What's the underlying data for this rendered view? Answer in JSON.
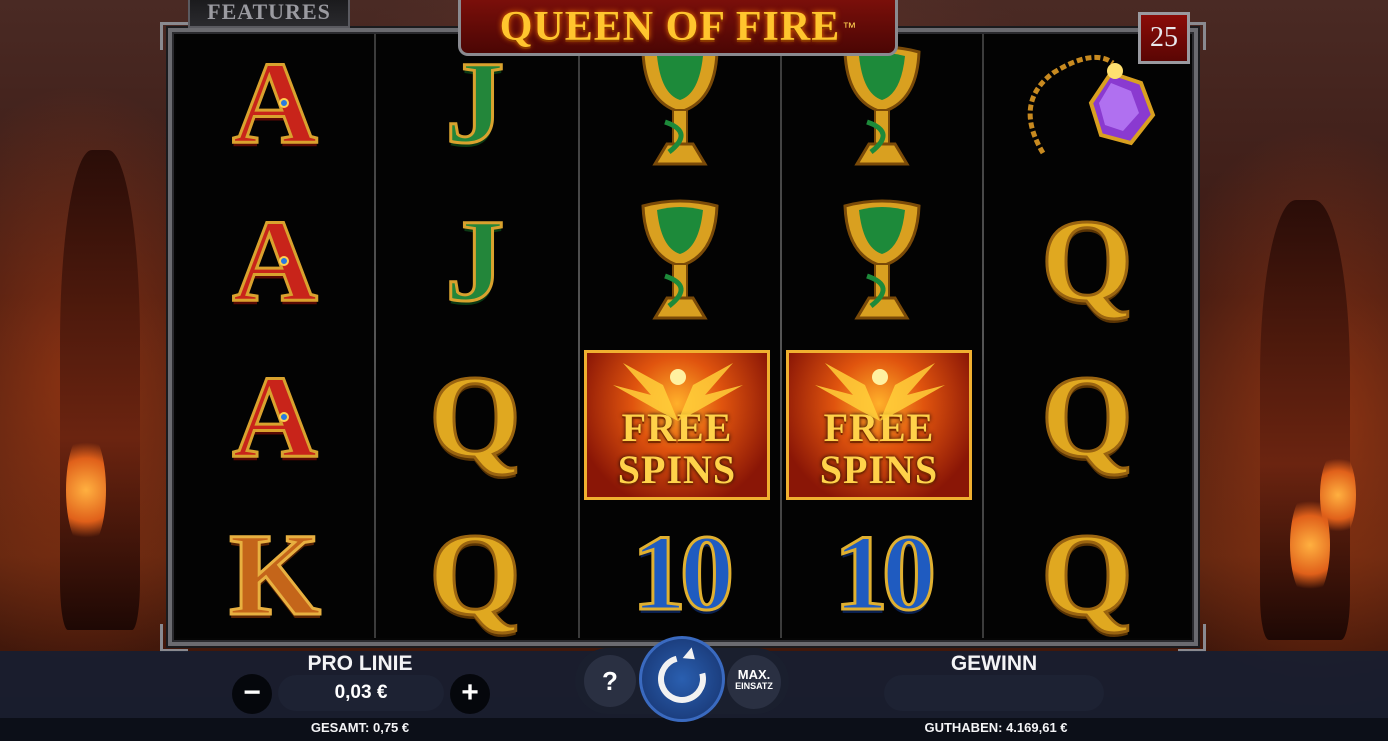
{
  "game": {
    "title": "QUEEN OF FIRE",
    "trademark": "™",
    "features_label": "FEATURES",
    "paylines": "25"
  },
  "reels": [
    [
      "A",
      "A",
      "A",
      "K"
    ],
    [
      "J",
      "J",
      "Q",
      "Q"
    ],
    [
      "chalice",
      "chalice",
      "FREE SPINS",
      "10"
    ],
    [
      "chalice",
      "chalice",
      "FREE SPINS",
      "10"
    ],
    [
      "amulet",
      "Q",
      "Q",
      "Q"
    ]
  ],
  "symbols": {
    "free_spins_line1": "FREE",
    "free_spins_line2": "SPINS",
    "ace": "A",
    "king": "K",
    "jack": "J",
    "queen": "Q",
    "ten": "10"
  },
  "controls": {
    "bet_label": "PRO LINIE",
    "bet_value": "0,03 €",
    "minus": "−",
    "plus": "+",
    "total_label": "GESAMT: 0,75 €",
    "help": "?",
    "max_bet_line1": "MAX.",
    "max_bet_line2": "EINSATZ",
    "win_label": "GEWINN",
    "win_value": "",
    "balance_label": "GUTHABEN: 4.169,61 €"
  },
  "colors": {
    "frame": "#6b6b70",
    "title_bg": "#7a0f0a",
    "title_text": "#ffc52e",
    "bar_bg": "#181e30",
    "spin_button": "#2a5fb0"
  }
}
